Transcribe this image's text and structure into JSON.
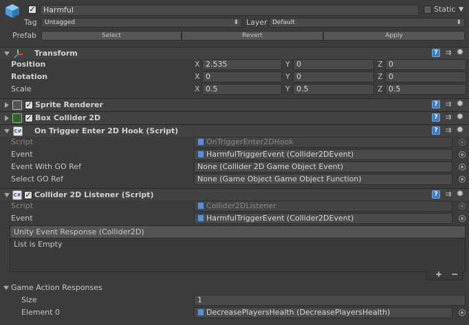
{
  "header": {
    "object_name": "Harmful",
    "static_label": "Static",
    "tag_label": "Tag",
    "tag_value": "Untagged",
    "layer_label": "Layer",
    "layer_value": "Default",
    "prefab_label": "Prefab",
    "select_label": "Select",
    "revert_label": "Revert",
    "apply_label": "Apply"
  },
  "transform": {
    "title": "Transform",
    "position_label": "Position",
    "rotation_label": "Rotation",
    "scale_label": "Scale",
    "axis_x": "X",
    "axis_y": "Y",
    "axis_z": "Z",
    "position": {
      "x": "2.535",
      "y": "0",
      "z": "0"
    },
    "rotation": {
      "x": "0",
      "y": "0",
      "z": "0"
    },
    "scale": {
      "x": "0.5",
      "y": "0.5",
      "z": "0.5"
    }
  },
  "sprite_renderer": {
    "title": "Sprite Renderer"
  },
  "box_collider": {
    "title": "Box Collider 2D"
  },
  "trigger_hook": {
    "title": "On Trigger Enter 2D Hook (Script)",
    "script_label": "Script",
    "script_value": "OnTriggerEnter2DHook",
    "event_label": "Event",
    "event_value": "HarmfulTriggerEvent (Collider2DEvent)",
    "go_ref_label": "Event With GO Ref",
    "go_ref_value": "None (Collider 2D Game Object Event)",
    "select_go_label": "Select GO Ref",
    "select_go_value": "None (Game Object Game Object Function)"
  },
  "listener": {
    "title": "Collider 2D Listener (Script)",
    "script_label": "Script",
    "script_value": "Collider2DListener",
    "event_label": "Event",
    "event_value": "HarmfulTriggerEvent (Collider2DEvent)",
    "unity_event_header": "Unity Event Response (Collider2D)",
    "list_empty": "List is Empty",
    "plus": "+",
    "minus": "−",
    "game_action_label": "Game Action Responses",
    "size_label": "Size",
    "size_value": "1",
    "element0_label": "Element 0",
    "element0_value": "DecreasePlayersHealth (DecreasePlayersHealth)"
  },
  "icons": {
    "book": "?",
    "preset": "⇉",
    "gear": "✹",
    "check": "✓"
  }
}
